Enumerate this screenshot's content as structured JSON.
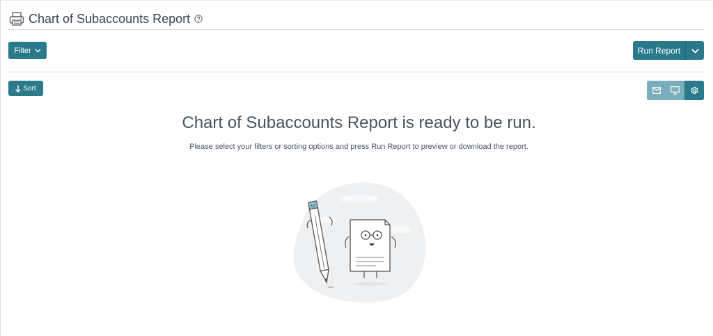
{
  "header": {
    "title": "Chart of Subaccounts Report",
    "printer_icon": "printer-icon",
    "help_icon": "help-circle-icon"
  },
  "filter": {
    "label": "Filter",
    "icon": "chevron-down-icon"
  },
  "run": {
    "label": "Run Report",
    "icon": "chevron-down-icon"
  },
  "sort": {
    "label": "Sort",
    "icon": "arrow-down-icon"
  },
  "view_toolbar": {
    "icons": [
      "mail-icon",
      "monitor-icon",
      "gear-icon"
    ]
  },
  "empty_state": {
    "title": "Chart of Subaccounts Report is ready to be run.",
    "subtitle": "Please select your filters or sorting options and press Run Report to preview or download the report."
  },
  "colors": {
    "primary": "#2a7a8c",
    "primary_light": "#79aebd",
    "text": "#3c4451",
    "divider": "#d8dcdf"
  }
}
